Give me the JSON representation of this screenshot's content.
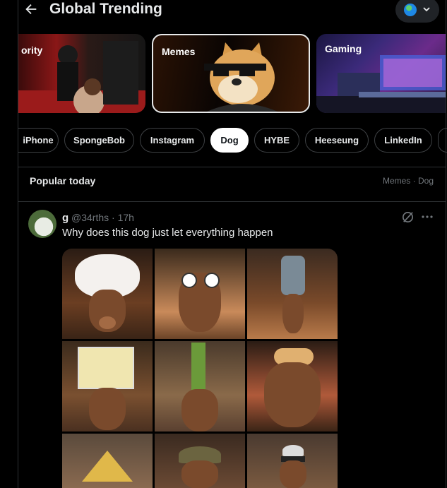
{
  "header": {
    "title": "Global Trending"
  },
  "cards": [
    {
      "label": "ority"
    },
    {
      "label": "Memes"
    },
    {
      "label": "Gaming"
    }
  ],
  "chips": [
    "iPhone",
    "SpongeBob",
    "Instagram",
    "Dog",
    "HYBE",
    "Heeseung",
    "LinkedIn"
  ],
  "popular": {
    "title": "Popular today",
    "meta": "Memes · Dog"
  },
  "tweet": {
    "author": "g",
    "handle": "@34rths · 17h",
    "text": "Why does this dog just let everything happen"
  },
  "images": [
    "dog with cotton candy on head",
    "dog with googly eyes",
    "dog with water jug on head",
    "dog with laptop on head",
    "dog with celery on head",
    "dog with hot dog on head",
    "dog with straw hat on head",
    "dog with camo cap",
    "dog with sunglasses and cap"
  ],
  "colors": {
    "accent": "#1d9bf0",
    "background": "#000000",
    "border": "#2f3336",
    "muted": "#71767b"
  }
}
